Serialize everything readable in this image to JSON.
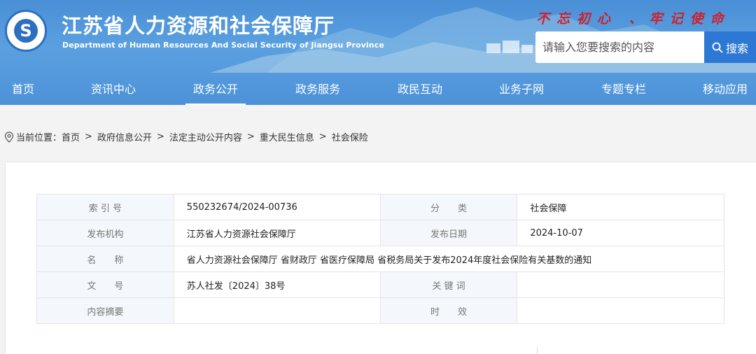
{
  "header": {
    "title": "江苏省人力资源和社会保障厅",
    "subtitle": "Department of Human Resources And Social Security of Jiangsu Province",
    "slogan": "不忘初心 、牢记使命",
    "search_placeholder": "请输入您要搜索的内容",
    "search_label": "搜索"
  },
  "nav": {
    "items": [
      {
        "label": "首页"
      },
      {
        "label": "资讯中心"
      },
      {
        "label": "政务公开"
      },
      {
        "label": "政务服务"
      },
      {
        "label": "政民互动"
      },
      {
        "label": "业务子网"
      },
      {
        "label": "专题专栏"
      },
      {
        "label": "移动应用"
      }
    ],
    "active_index": 2
  },
  "breadcrumb": {
    "prefix": "当前位置：",
    "items": [
      "首页",
      "政府信息公开",
      "法定主动公开内容",
      "重大民生信息",
      "社会保险"
    ],
    "separator": ">"
  },
  "meta_table": {
    "rows": [
      {
        "l1": "索 引 号",
        "v1": "550232674/2024-00736",
        "l2": "分　　类",
        "v2": "社会保障"
      },
      {
        "l1": "发布机构",
        "v1": "江苏省人力资源社会保障厅",
        "l2": "发布日期",
        "v2": "2024-10-07"
      },
      {
        "l1": "名　　称",
        "v1": "省人力资源社会保障厅 省财政厅 省医疗保障局 省税务局关于发布2024年度社会保险有关基数的通知"
      },
      {
        "l1": "文　　号",
        "v1": "苏人社发〔2024〕38号",
        "l2": "关 键 词",
        "v2": ""
      },
      {
        "l1": "内容摘要",
        "v1": "",
        "l2": "时　　效",
        "v2": ""
      }
    ]
  },
  "colors": {
    "header_blue": "#4d92d8",
    "search_button": "#2d78d4",
    "slogan_red": "#d0202a",
    "label_bg": "#f4f7fb"
  }
}
